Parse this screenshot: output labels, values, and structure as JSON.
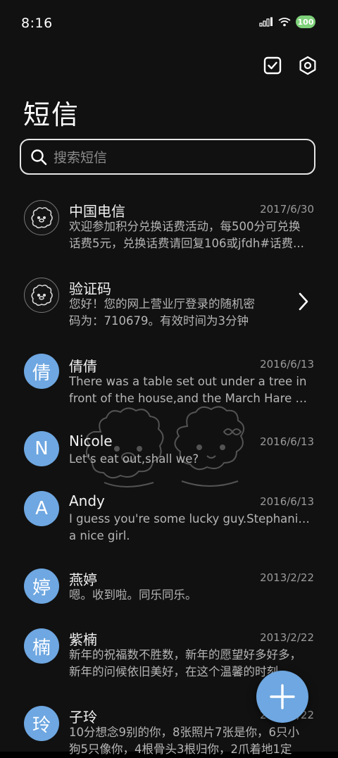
{
  "status": {
    "time": "8:16",
    "battery": "100"
  },
  "header": {
    "title": "短信"
  },
  "search": {
    "placeholder": "搜索短信"
  },
  "messages": [
    {
      "name": "中国电信",
      "date": "2017/6/30",
      "avatar_type": "bear",
      "line1": "欢迎参加积分兑换话费活动，每500分可兑换",
      "line2": "话费5元，兑换话费请回复106或jfdh#话费..."
    },
    {
      "name": "验证码",
      "date": "",
      "avatar_type": "bear",
      "line1": "您好！您的网上营业厅登录的随机密",
      "line2": "码为：710679。有效时间为3分钟"
    },
    {
      "name": "倩倩",
      "date": "2016/6/13",
      "avatar_letter": "倩",
      "line1": "There was a table set out under a tree in",
      "line2": "front of the house,and the March Hare an..."
    },
    {
      "name": "Nicole",
      "date": "2016/6/13",
      "avatar_letter": "N",
      "line1": "Let's eat out,shall we?",
      "line2": ""
    },
    {
      "name": "Andy",
      "date": "2016/6/13",
      "avatar_letter": "A",
      "line1": "I guess you're some lucky guy.Stephanie is",
      "line2": "a nice girl."
    },
    {
      "name": "燕婷",
      "date": "2013/2/22",
      "avatar_letter": "婷",
      "line1": "嗯。收到啦。同乐同乐。",
      "line2": ""
    },
    {
      "name": "紫楠",
      "date": "2013/2/22",
      "avatar_letter": "楠",
      "line1": "新年的祝福数不胜数，新年的愿望好多好多，",
      "line2": "新年的问候依旧美好，在这个温馨的时刻..."
    },
    {
      "name": "子玲",
      "date": "2013/2/22",
      "avatar_letter": "玲",
      "line1": "10分想念9别的你，8张照片7张是你，6只小",
      "line2": "狗5只像你，4根骨头3根归你，2爪着地1定"
    }
  ],
  "icons": {
    "select_all": "checkbox-icon",
    "settings": "settings-icon",
    "search": "search-icon",
    "compose": "plus-icon",
    "chevron": "chevron-right-icon"
  },
  "colors": {
    "accent": "#6ea7e1",
    "background": "#111111"
  }
}
